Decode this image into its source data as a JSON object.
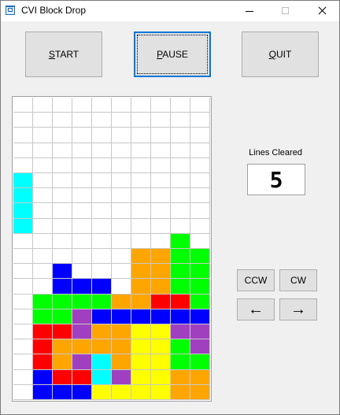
{
  "window": {
    "title": "CVI Block Drop"
  },
  "toolbar": {
    "start": {
      "label": "START",
      "mnemonic": "S",
      "rest": "TART"
    },
    "pause": {
      "label": "PAUSE",
      "mnemonic": "P",
      "rest": "AUSE"
    },
    "quit": {
      "label": "QUIT",
      "mnemonic": "Q",
      "rest": "UIT"
    }
  },
  "score": {
    "label": "Lines Cleared",
    "value": "5"
  },
  "controls": {
    "ccw_label": "CCW",
    "cw_label": "CW",
    "left_arrow": "←",
    "right_arrow": "→"
  },
  "icons": {
    "app": "app-window-icon",
    "minimize": "minimize-icon",
    "maximize": "maximize-icon",
    "close": "close-icon",
    "left": "arrow-left-icon",
    "right": "arrow-right-icon"
  },
  "colors": {
    "C": "#00ffff",
    "B": "#0000ff",
    "O": "#ffa500",
    "G": "#00ff00",
    "R": "#ff0000",
    "P": "#a040c0",
    "Y": "#ffff00",
    ".": "#ffffff",
    "accent": "#0078d7"
  },
  "board": {
    "cols": 10,
    "rows": [
      "..........",
      "..........",
      "..........",
      "..........",
      "..........",
      "C.........",
      "C.........",
      "C.........",
      "C.........",
      "........G.",
      "......OOGG",
      "..B...OOGG",
      "..BBB.OOGG",
      ".GGGGOORRG",
      ".GGPBBBBBB",
      ".RRPOOYYPP",
      ".ROOOOYYGP",
      ".ROPCOYYGG",
      ".BRRCPYYOO",
      ".BBBYYYYOO"
    ]
  }
}
